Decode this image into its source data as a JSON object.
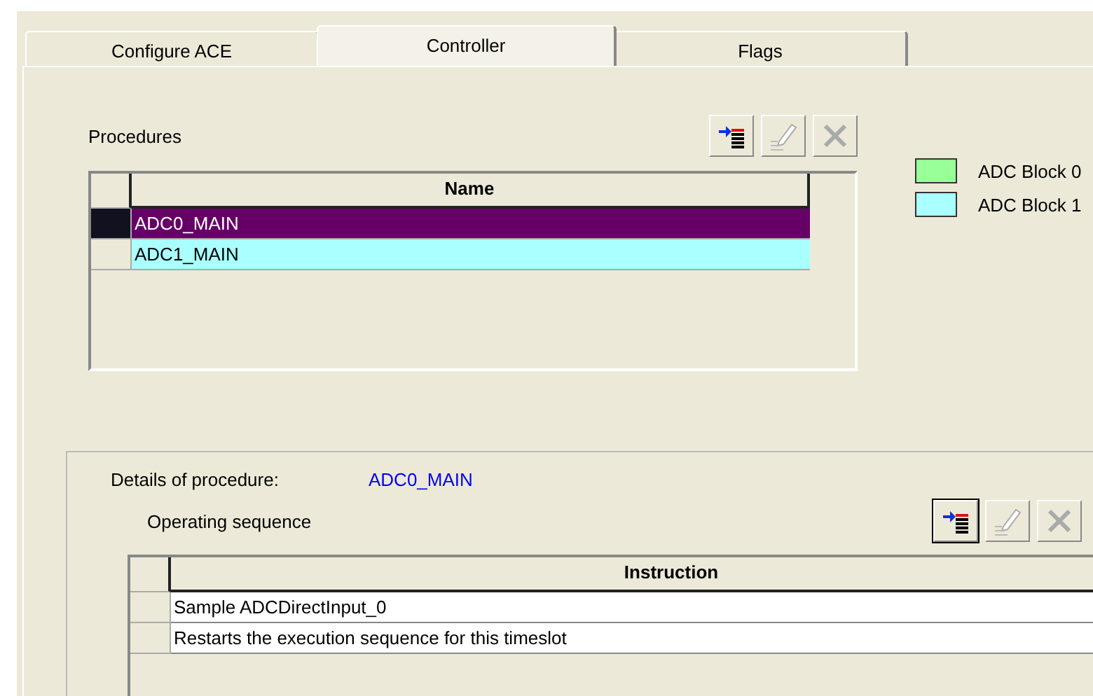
{
  "tabs": [
    {
      "label": "Configure ACE",
      "selected": false
    },
    {
      "label": "Controller",
      "selected": true
    },
    {
      "label": "Flags",
      "selected": false
    }
  ],
  "procedures": {
    "label": "Procedures",
    "toolbar": [
      {
        "kind": "add",
        "disabled": false,
        "focused": false
      },
      {
        "kind": "edit",
        "disabled": true,
        "focused": false
      },
      {
        "kind": "delete",
        "disabled": true,
        "focused": false
      }
    ],
    "columns": [
      "Name"
    ],
    "rows": [
      {
        "name": "ADC0_MAIN",
        "selected": true,
        "color": "#660066"
      },
      {
        "name": "ADC1_MAIN",
        "selected": false,
        "color": "#aaffff"
      }
    ]
  },
  "legend": [
    {
      "label": "ADC Block 0",
      "color": "#99ff99"
    },
    {
      "label": "ADC Block 1",
      "color": "#aaffff"
    }
  ],
  "details": {
    "label": "Details of procedure:",
    "value": "ADC0_MAIN",
    "sequence_label": "Operating sequence",
    "toolbar": [
      {
        "kind": "add",
        "disabled": false,
        "focused": true
      },
      {
        "kind": "edit",
        "disabled": true,
        "focused": false
      },
      {
        "kind": "delete",
        "disabled": true,
        "focused": false
      }
    ],
    "columns": [
      "Instruction"
    ],
    "rows": [
      {
        "instruction": "Sample ADCDirectInput_0"
      },
      {
        "instruction": "Restarts the execution sequence for this timeslot"
      }
    ]
  }
}
